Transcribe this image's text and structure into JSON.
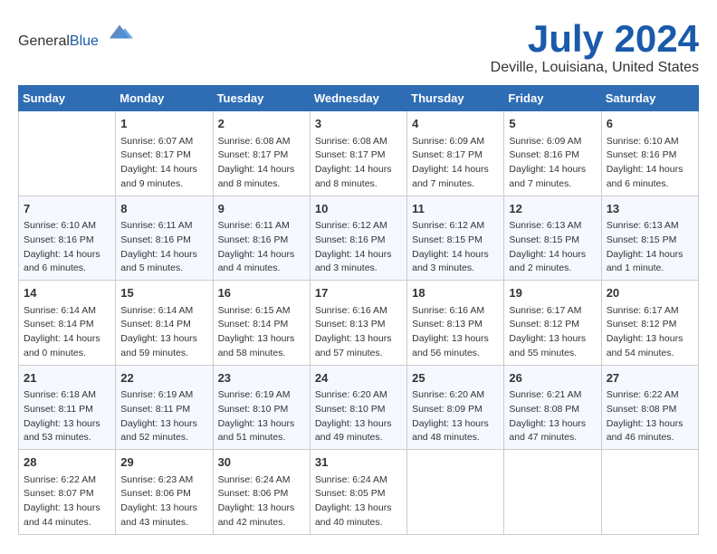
{
  "header": {
    "logo_general": "General",
    "logo_blue": "Blue",
    "month_title": "July 2024",
    "location": "Deville, Louisiana, United States"
  },
  "columns": [
    "Sunday",
    "Monday",
    "Tuesday",
    "Wednesday",
    "Thursday",
    "Friday",
    "Saturday"
  ],
  "weeks": [
    [
      {
        "day": "",
        "sunrise": "",
        "sunset": "",
        "daylight": ""
      },
      {
        "day": "1",
        "sunrise": "Sunrise: 6:07 AM",
        "sunset": "Sunset: 8:17 PM",
        "daylight": "Daylight: 14 hours and 9 minutes."
      },
      {
        "day": "2",
        "sunrise": "Sunrise: 6:08 AM",
        "sunset": "Sunset: 8:17 PM",
        "daylight": "Daylight: 14 hours and 8 minutes."
      },
      {
        "day": "3",
        "sunrise": "Sunrise: 6:08 AM",
        "sunset": "Sunset: 8:17 PM",
        "daylight": "Daylight: 14 hours and 8 minutes."
      },
      {
        "day": "4",
        "sunrise": "Sunrise: 6:09 AM",
        "sunset": "Sunset: 8:17 PM",
        "daylight": "Daylight: 14 hours and 7 minutes."
      },
      {
        "day": "5",
        "sunrise": "Sunrise: 6:09 AM",
        "sunset": "Sunset: 8:16 PM",
        "daylight": "Daylight: 14 hours and 7 minutes."
      },
      {
        "day": "6",
        "sunrise": "Sunrise: 6:10 AM",
        "sunset": "Sunset: 8:16 PM",
        "daylight": "Daylight: 14 hours and 6 minutes."
      }
    ],
    [
      {
        "day": "7",
        "sunrise": "Sunrise: 6:10 AM",
        "sunset": "Sunset: 8:16 PM",
        "daylight": "Daylight: 14 hours and 6 minutes."
      },
      {
        "day": "8",
        "sunrise": "Sunrise: 6:11 AM",
        "sunset": "Sunset: 8:16 PM",
        "daylight": "Daylight: 14 hours and 5 minutes."
      },
      {
        "day": "9",
        "sunrise": "Sunrise: 6:11 AM",
        "sunset": "Sunset: 8:16 PM",
        "daylight": "Daylight: 14 hours and 4 minutes."
      },
      {
        "day": "10",
        "sunrise": "Sunrise: 6:12 AM",
        "sunset": "Sunset: 8:16 PM",
        "daylight": "Daylight: 14 hours and 3 minutes."
      },
      {
        "day": "11",
        "sunrise": "Sunrise: 6:12 AM",
        "sunset": "Sunset: 8:15 PM",
        "daylight": "Daylight: 14 hours and 3 minutes."
      },
      {
        "day": "12",
        "sunrise": "Sunrise: 6:13 AM",
        "sunset": "Sunset: 8:15 PM",
        "daylight": "Daylight: 14 hours and 2 minutes."
      },
      {
        "day": "13",
        "sunrise": "Sunrise: 6:13 AM",
        "sunset": "Sunset: 8:15 PM",
        "daylight": "Daylight: 14 hours and 1 minute."
      }
    ],
    [
      {
        "day": "14",
        "sunrise": "Sunrise: 6:14 AM",
        "sunset": "Sunset: 8:14 PM",
        "daylight": "Daylight: 14 hours and 0 minutes."
      },
      {
        "day": "15",
        "sunrise": "Sunrise: 6:14 AM",
        "sunset": "Sunset: 8:14 PM",
        "daylight": "Daylight: 13 hours and 59 minutes."
      },
      {
        "day": "16",
        "sunrise": "Sunrise: 6:15 AM",
        "sunset": "Sunset: 8:14 PM",
        "daylight": "Daylight: 13 hours and 58 minutes."
      },
      {
        "day": "17",
        "sunrise": "Sunrise: 6:16 AM",
        "sunset": "Sunset: 8:13 PM",
        "daylight": "Daylight: 13 hours and 57 minutes."
      },
      {
        "day": "18",
        "sunrise": "Sunrise: 6:16 AM",
        "sunset": "Sunset: 8:13 PM",
        "daylight": "Daylight: 13 hours and 56 minutes."
      },
      {
        "day": "19",
        "sunrise": "Sunrise: 6:17 AM",
        "sunset": "Sunset: 8:12 PM",
        "daylight": "Daylight: 13 hours and 55 minutes."
      },
      {
        "day": "20",
        "sunrise": "Sunrise: 6:17 AM",
        "sunset": "Sunset: 8:12 PM",
        "daylight": "Daylight: 13 hours and 54 minutes."
      }
    ],
    [
      {
        "day": "21",
        "sunrise": "Sunrise: 6:18 AM",
        "sunset": "Sunset: 8:11 PM",
        "daylight": "Daylight: 13 hours and 53 minutes."
      },
      {
        "day": "22",
        "sunrise": "Sunrise: 6:19 AM",
        "sunset": "Sunset: 8:11 PM",
        "daylight": "Daylight: 13 hours and 52 minutes."
      },
      {
        "day": "23",
        "sunrise": "Sunrise: 6:19 AM",
        "sunset": "Sunset: 8:10 PM",
        "daylight": "Daylight: 13 hours and 51 minutes."
      },
      {
        "day": "24",
        "sunrise": "Sunrise: 6:20 AM",
        "sunset": "Sunset: 8:10 PM",
        "daylight": "Daylight: 13 hours and 49 minutes."
      },
      {
        "day": "25",
        "sunrise": "Sunrise: 6:20 AM",
        "sunset": "Sunset: 8:09 PM",
        "daylight": "Daylight: 13 hours and 48 minutes."
      },
      {
        "day": "26",
        "sunrise": "Sunrise: 6:21 AM",
        "sunset": "Sunset: 8:08 PM",
        "daylight": "Daylight: 13 hours and 47 minutes."
      },
      {
        "day": "27",
        "sunrise": "Sunrise: 6:22 AM",
        "sunset": "Sunset: 8:08 PM",
        "daylight": "Daylight: 13 hours and 46 minutes."
      }
    ],
    [
      {
        "day": "28",
        "sunrise": "Sunrise: 6:22 AM",
        "sunset": "Sunset: 8:07 PM",
        "daylight": "Daylight: 13 hours and 44 minutes."
      },
      {
        "day": "29",
        "sunrise": "Sunrise: 6:23 AM",
        "sunset": "Sunset: 8:06 PM",
        "daylight": "Daylight: 13 hours and 43 minutes."
      },
      {
        "day": "30",
        "sunrise": "Sunrise: 6:24 AM",
        "sunset": "Sunset: 8:06 PM",
        "daylight": "Daylight: 13 hours and 42 minutes."
      },
      {
        "day": "31",
        "sunrise": "Sunrise: 6:24 AM",
        "sunset": "Sunset: 8:05 PM",
        "daylight": "Daylight: 13 hours and 40 minutes."
      },
      {
        "day": "",
        "sunrise": "",
        "sunset": "",
        "daylight": ""
      },
      {
        "day": "",
        "sunrise": "",
        "sunset": "",
        "daylight": ""
      },
      {
        "day": "",
        "sunrise": "",
        "sunset": "",
        "daylight": ""
      }
    ]
  ]
}
